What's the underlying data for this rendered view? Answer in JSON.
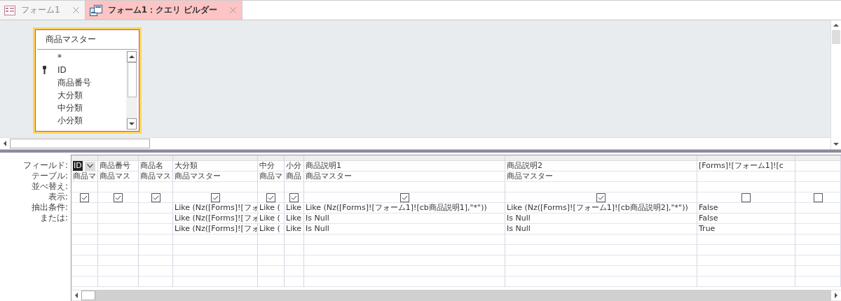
{
  "tabs": [
    {
      "label": "フォーム1",
      "selected": false
    },
    {
      "label": "フォーム1：クエリ ビルダー",
      "selected": true
    }
  ],
  "field_list": {
    "title": "商品マスター",
    "fields": [
      {
        "name": "*",
        "primary_key": false
      },
      {
        "name": "ID",
        "primary_key": true
      },
      {
        "name": "商品番号",
        "primary_key": false
      },
      {
        "name": "大分類",
        "primary_key": false
      },
      {
        "name": "中分類",
        "primary_key": false
      },
      {
        "name": "小分類",
        "primary_key": false
      }
    ]
  },
  "grid": {
    "row_labels": [
      "フィールド:",
      "テーブル:",
      "並べ替え:",
      "表示:",
      "抽出条件:",
      "または:"
    ],
    "columns": [
      {
        "field": "ID",
        "editing": true,
        "table": "商品マ",
        "show": true
      },
      {
        "field": "商品番号",
        "editing": false,
        "table": "商品マス",
        "show": true
      },
      {
        "field": "商品名",
        "editing": false,
        "table": "商品マス",
        "show": true
      },
      {
        "field": "大分類",
        "editing": false,
        "table": "商品マスター",
        "show": true,
        "criteria": [
          "Like (Nz([Forms]![フォ",
          "Like (Nz([Forms]![フォ",
          "Like (Nz([Forms]![フォ"
        ]
      },
      {
        "field": "中分",
        "editing": false,
        "table": "商品マ",
        "show": true,
        "criteria": [
          "Like (",
          "Like (",
          "Like ("
        ]
      },
      {
        "field": "小分",
        "editing": false,
        "table": "商品",
        "show": true,
        "criteria": [
          "Like",
          "Like",
          "Like"
        ]
      },
      {
        "field": "商品説明1",
        "editing": false,
        "table": "商品マスター",
        "show": true,
        "criteria": [
          "Like (Nz([Forms]![フォーム1]![cb商品説明1],\"*\"))",
          "Is Null",
          "Is Null"
        ]
      },
      {
        "field": "商品説明2",
        "editing": false,
        "table": "商品マスター",
        "show": true,
        "criteria": [
          "Like (Nz([Forms]![フォーム1]![cb商品説明2],\"*\"))",
          "Is Null",
          "Is Null"
        ]
      },
      {
        "field": "[Forms]![フォーム1]![c",
        "editing": false,
        "show": false,
        "criteria": [
          "False",
          "False",
          "True"
        ]
      },
      {
        "editing": false,
        "show": false
      }
    ]
  }
}
